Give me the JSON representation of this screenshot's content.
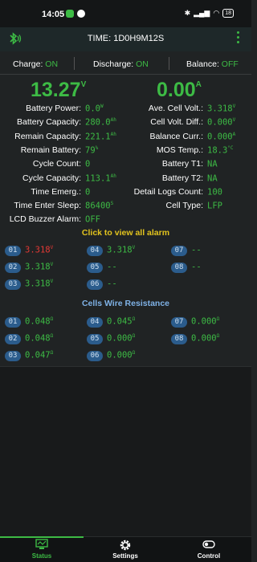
{
  "status_bar": {
    "time": "14:05",
    "battery": "18"
  },
  "header": {
    "time_text": "TIME: 1D0H9M12S"
  },
  "switches": {
    "charge_label": "Charge:",
    "charge_value": "ON",
    "discharge_label": "Discharge:",
    "discharge_value": "ON",
    "balance_label": "Balance:",
    "balance_value": "OFF"
  },
  "voltage": {
    "value": "13.27",
    "unit": "V"
  },
  "current": {
    "value": "0.00",
    "unit": "A"
  },
  "left_rows": [
    {
      "label": "Battery Power:",
      "value": "0.0",
      "unit": "W"
    },
    {
      "label": "Battery Capacity:",
      "value": "280.0",
      "unit": "Ah"
    },
    {
      "label": "Remain Capacity:",
      "value": "221.1",
      "unit": "Ah"
    },
    {
      "label": "Remain Battery:",
      "value": "79",
      "unit": "%"
    },
    {
      "label": "Cycle Count:",
      "value": "0",
      "unit": ""
    },
    {
      "label": "Cycle Capacity:",
      "value": "113.1",
      "unit": "Ah"
    },
    {
      "label": "Time Emerg.:",
      "value": "0",
      "unit": ""
    },
    {
      "label": "Time Enter Sleep:",
      "value": "86400",
      "unit": "S"
    },
    {
      "label": "LCD Buzzer Alarm:",
      "value": "OFF",
      "unit": ""
    }
  ],
  "right_rows": [
    {
      "label": "Ave. Cell Volt.:",
      "value": "3.318",
      "unit": "V"
    },
    {
      "label": "Cell Volt. Diff.:",
      "value": "0.000",
      "unit": "V"
    },
    {
      "label": "Balance Curr.:",
      "value": "0.000",
      "unit": "A"
    },
    {
      "label": "MOS Temp.:",
      "value": "18.3",
      "unit": "°C"
    },
    {
      "label": "Battery T1:",
      "value": "NA",
      "unit": ""
    },
    {
      "label": "Battery T2:",
      "value": "NA",
      "unit": ""
    },
    {
      "label": "Detail Logs Count:",
      "value": "100",
      "unit": ""
    },
    {
      "label": "Cell Type:",
      "value": "LFP",
      "unit": ""
    }
  ],
  "alarm_link": "Click to view all alarm",
  "cells": [
    {
      "num": "01",
      "value": "3.318",
      "unit": "V",
      "red": true
    },
    {
      "num": "02",
      "value": "3.318",
      "unit": "V"
    },
    {
      "num": "03",
      "value": "3.318",
      "unit": "V"
    },
    {
      "num": "04",
      "value": "3.318",
      "unit": "V"
    },
    {
      "num": "05",
      "value": "--",
      "unit": ""
    },
    {
      "num": "06",
      "value": "--",
      "unit": ""
    },
    {
      "num": "07",
      "value": "--",
      "unit": ""
    },
    {
      "num": "08",
      "value": "--",
      "unit": ""
    }
  ],
  "wire_resistance_title": "Cells Wire Resistance",
  "wires": [
    {
      "num": "01",
      "value": "0.048",
      "unit": "Ω"
    },
    {
      "num": "02",
      "value": "0.048",
      "unit": "Ω"
    },
    {
      "num": "03",
      "value": "0.047",
      "unit": "Ω"
    },
    {
      "num": "04",
      "value": "0.045",
      "unit": "Ω"
    },
    {
      "num": "05",
      "value": "0.000",
      "unit": "Ω"
    },
    {
      "num": "06",
      "value": "0.000",
      "unit": "Ω"
    },
    {
      "num": "07",
      "value": "0.000",
      "unit": "Ω"
    },
    {
      "num": "08",
      "value": "0.000",
      "unit": "Ω"
    }
  ],
  "nav": {
    "status": "Status",
    "settings": "Settings",
    "control": "Control"
  },
  "colors": {
    "accent_green": "#3dbb45",
    "alarm_yellow": "#e3c41e",
    "cell_pill_blue": "#2b5c8c",
    "alarm_red": "#e53935"
  },
  "icons": {
    "bluetooth": "bluetooth-icon",
    "menu": "more-vert-icon",
    "status": "monitor-icon",
    "settings": "gear-icon",
    "control": "toggle-icon"
  }
}
